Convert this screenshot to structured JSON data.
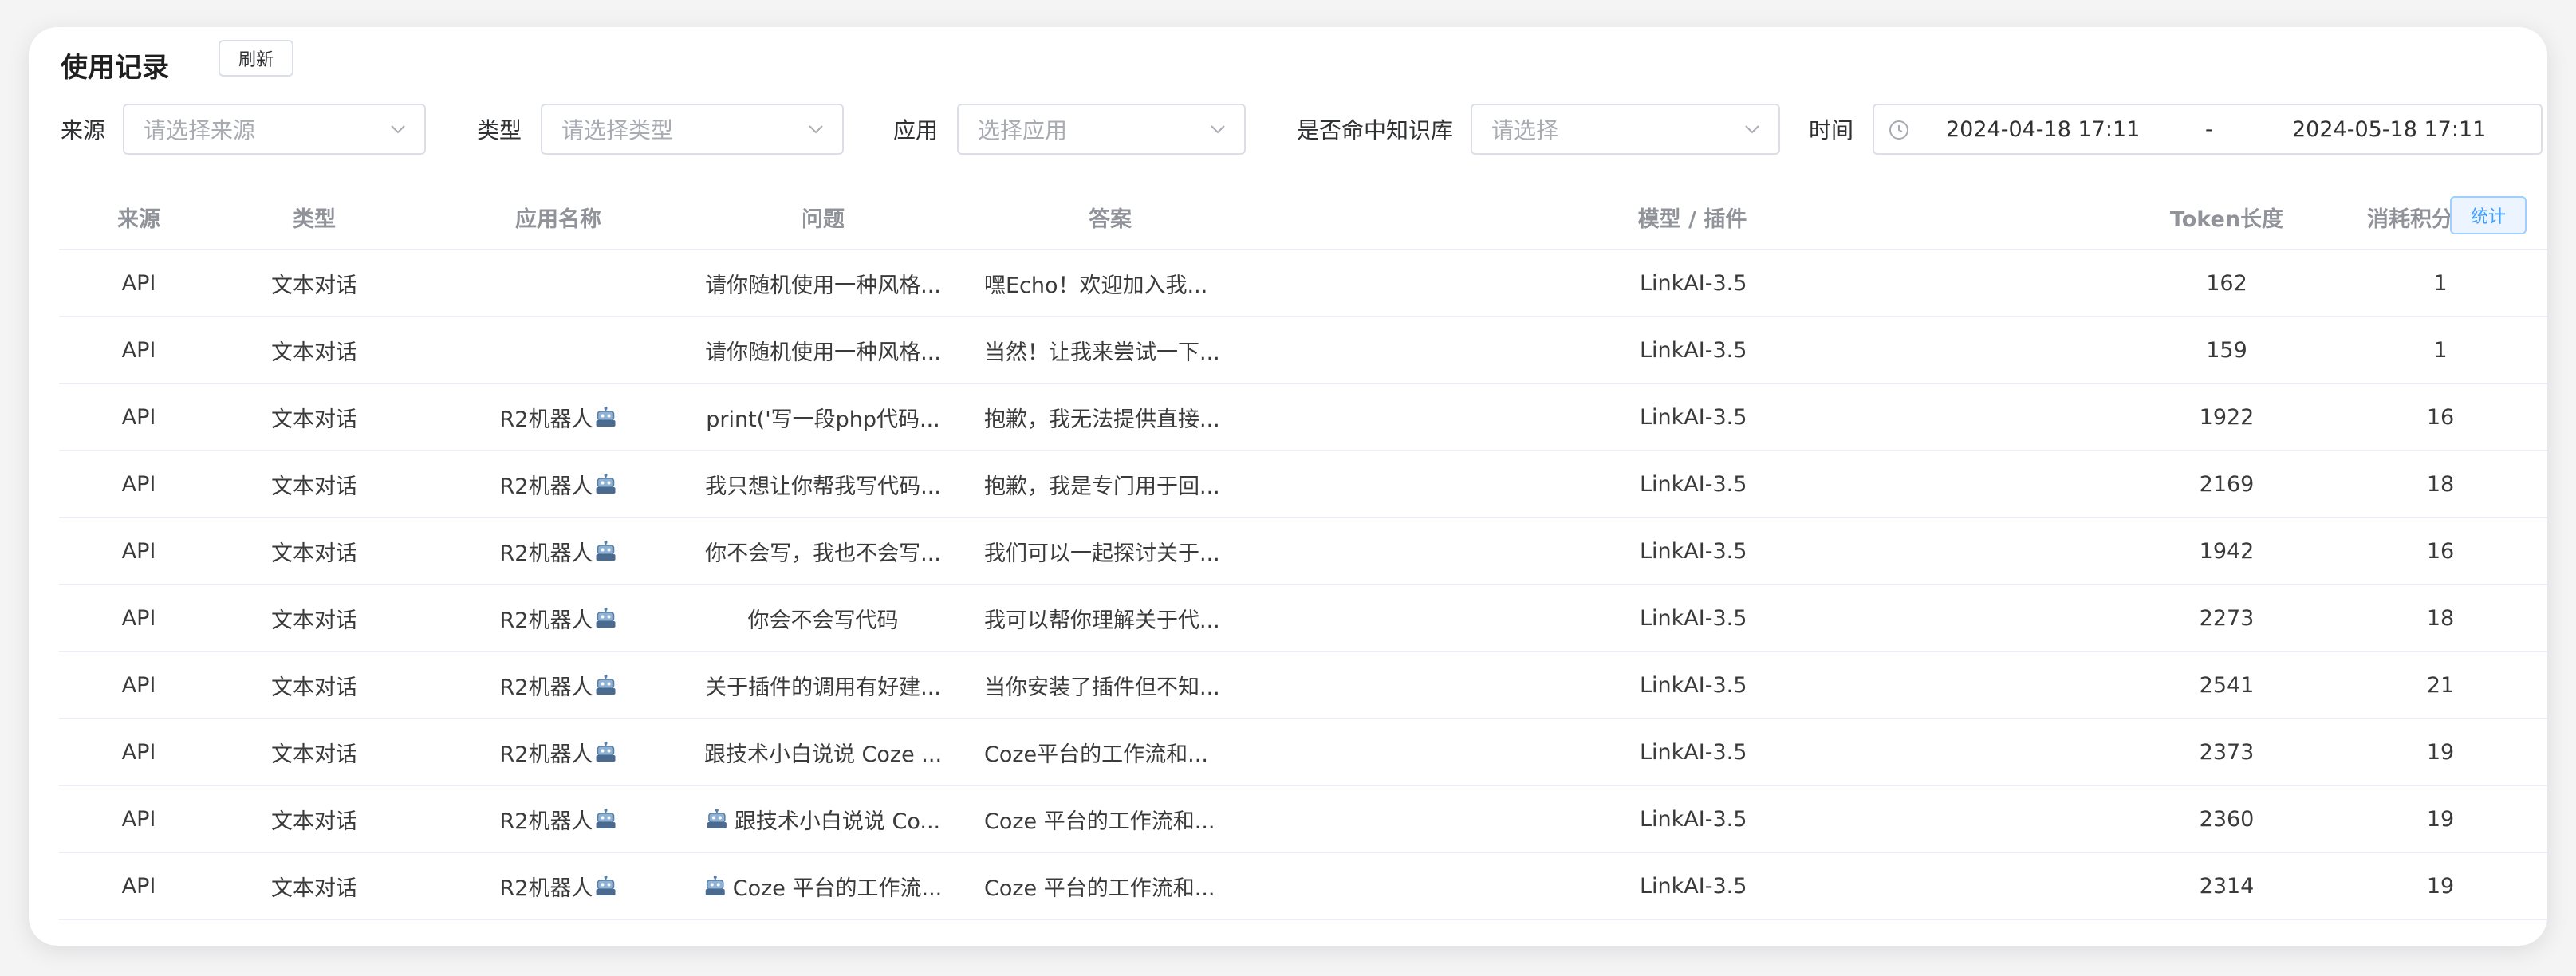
{
  "header": {
    "title": "使用记录",
    "refresh_label": "刷新"
  },
  "filters": {
    "source": {
      "label": "来源",
      "placeholder": "请选择来源"
    },
    "type": {
      "label": "类型",
      "placeholder": "请选择类型"
    },
    "app": {
      "label": "应用",
      "placeholder": "选择应用"
    },
    "kb_hit": {
      "label": "是否命中知识库",
      "placeholder": "请选择"
    },
    "time": {
      "label": "时间",
      "start": "2024-04-18 17:11",
      "separator": "-",
      "end": "2024-05-18 17:11"
    }
  },
  "table": {
    "columns": {
      "source": "来源",
      "type": "类型",
      "app_name": "应用名称",
      "question": "问题",
      "answer": "答案",
      "model": "模型 / 插件",
      "tokens": "Token长度",
      "points": "消耗积分"
    },
    "stat_label": "统计",
    "rows": [
      {
        "source": "API",
        "type": "文本对话",
        "app_name": "",
        "app_icon": "",
        "q_icon": "",
        "question": "请你随机使用一种风格...",
        "answer": "嘿Echo！欢迎加入我...",
        "model": "LinkAI-3.5",
        "tokens": "162",
        "points": "1"
      },
      {
        "source": "API",
        "type": "文本对话",
        "app_name": "",
        "app_icon": "",
        "q_icon": "",
        "question": "请你随机使用一种风格...",
        "answer": "当然！让我来尝试一下...",
        "model": "LinkAI-3.5",
        "tokens": "159",
        "points": "1"
      },
      {
        "source": "API",
        "type": "文本对话",
        "app_name": "R2机器人",
        "app_icon": "robot-icon",
        "q_icon": "",
        "question": "print('写一段php代码...",
        "answer": "抱歉，我无法提供直接...",
        "model": "LinkAI-3.5",
        "tokens": "1922",
        "points": "16"
      },
      {
        "source": "API",
        "type": "文本对话",
        "app_name": "R2机器人",
        "app_icon": "robot-icon",
        "q_icon": "",
        "question": "我只想让你帮我写代码...",
        "answer": "抱歉，我是专门用于回...",
        "model": "LinkAI-3.5",
        "tokens": "2169",
        "points": "18"
      },
      {
        "source": "API",
        "type": "文本对话",
        "app_name": "R2机器人",
        "app_icon": "robot-icon",
        "q_icon": "",
        "question": "你不会写，我也不会写...",
        "answer": "我们可以一起探讨关于...",
        "model": "LinkAI-3.5",
        "tokens": "1942",
        "points": "16"
      },
      {
        "source": "API",
        "type": "文本对话",
        "app_name": "R2机器人",
        "app_icon": "robot-icon",
        "q_icon": "",
        "question": "你会不会写代码",
        "answer": "我可以帮你理解关于代...",
        "model": "LinkAI-3.5",
        "tokens": "2273",
        "points": "18"
      },
      {
        "source": "API",
        "type": "文本对话",
        "app_name": "R2机器人",
        "app_icon": "robot-icon",
        "q_icon": "",
        "question": "关于插件的调用有好建...",
        "answer": "当你安装了插件但不知...",
        "model": "LinkAI-3.5",
        "tokens": "2541",
        "points": "21"
      },
      {
        "source": "API",
        "type": "文本对话",
        "app_name": "R2机器人",
        "app_icon": "robot-icon",
        "q_icon": "",
        "question": "跟技术小白说说 Coze ...",
        "answer": "Coze平台的工作流和...",
        "model": "LinkAI-3.5",
        "tokens": "2373",
        "points": "19"
      },
      {
        "source": "API",
        "type": "文本对话",
        "app_name": "R2机器人",
        "app_icon": "robot-icon",
        "q_icon": "robot-icon",
        "question": "跟技术小白说说 Co...",
        "answer": "Coze 平台的工作流和...",
        "model": "LinkAI-3.5",
        "tokens": "2360",
        "points": "19"
      },
      {
        "source": "API",
        "type": "文本对话",
        "app_name": "R2机器人",
        "app_icon": "robot-icon",
        "q_icon": "robot-icon",
        "question": "Coze 平台的工作流...",
        "answer": "Coze 平台的工作流和...",
        "model": "LinkAI-3.5",
        "tokens": "2314",
        "points": "19"
      }
    ]
  }
}
